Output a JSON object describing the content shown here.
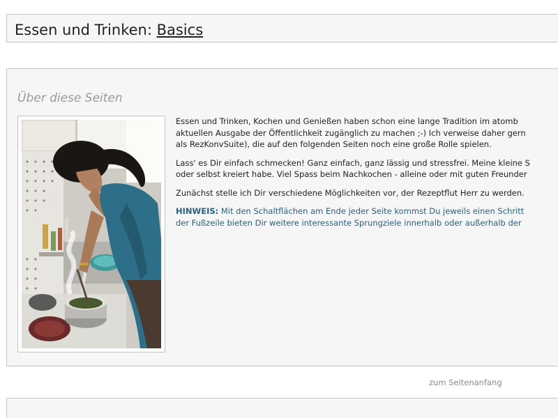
{
  "header": {
    "title_prefix": "Essen und Trinken: ",
    "title_link": "Basics"
  },
  "section": {
    "title": "Über diese Seiten",
    "photo_icon": "person-cooking-photo",
    "paragraphs": {
      "p1": [
        "Essen und Trinken, Kochen und Genießen haben schon eine lange Tradition im atomb",
        "aktuellen Ausgabe der Öffentlichkeit zugänglich zu machen ;-) Ich verweise daher gern",
        "als RezKonvSuite), die auf den folgenden Seiten noch eine große Rolle spielen."
      ],
      "p2": [
        "Lass' es Dir einfach schmecken! Ganz einfach, ganz lässig und stressfrei. Meine kleine S",
        "oder selbst kreiert habe. Viel Spass beim Nachkochen - alleine oder mit guten Freunder"
      ],
      "p3": [
        "Zunächst stelle ich Dir verschiedene Möglichkeiten vor, der Rezeptflut Herr zu werden."
      ],
      "hint_label": "HINWEIS:",
      "hint_line1_rest": " Mit den Schaltflächen am Ende jeder Seite kommst Du jeweils einen Schritt",
      "hint_line2": "der Fußzeile bieten Dir weitere interessante Sprungziele innerhalb oder außerhalb der"
    }
  },
  "nav": {
    "top_link": "zum Seitenanfang"
  },
  "colors": {
    "panel_bg": "#f6f6f6",
    "panel_border": "#c4c4c4",
    "hint_text": "#2a5f80",
    "section_title": "#9a9a9a"
  }
}
